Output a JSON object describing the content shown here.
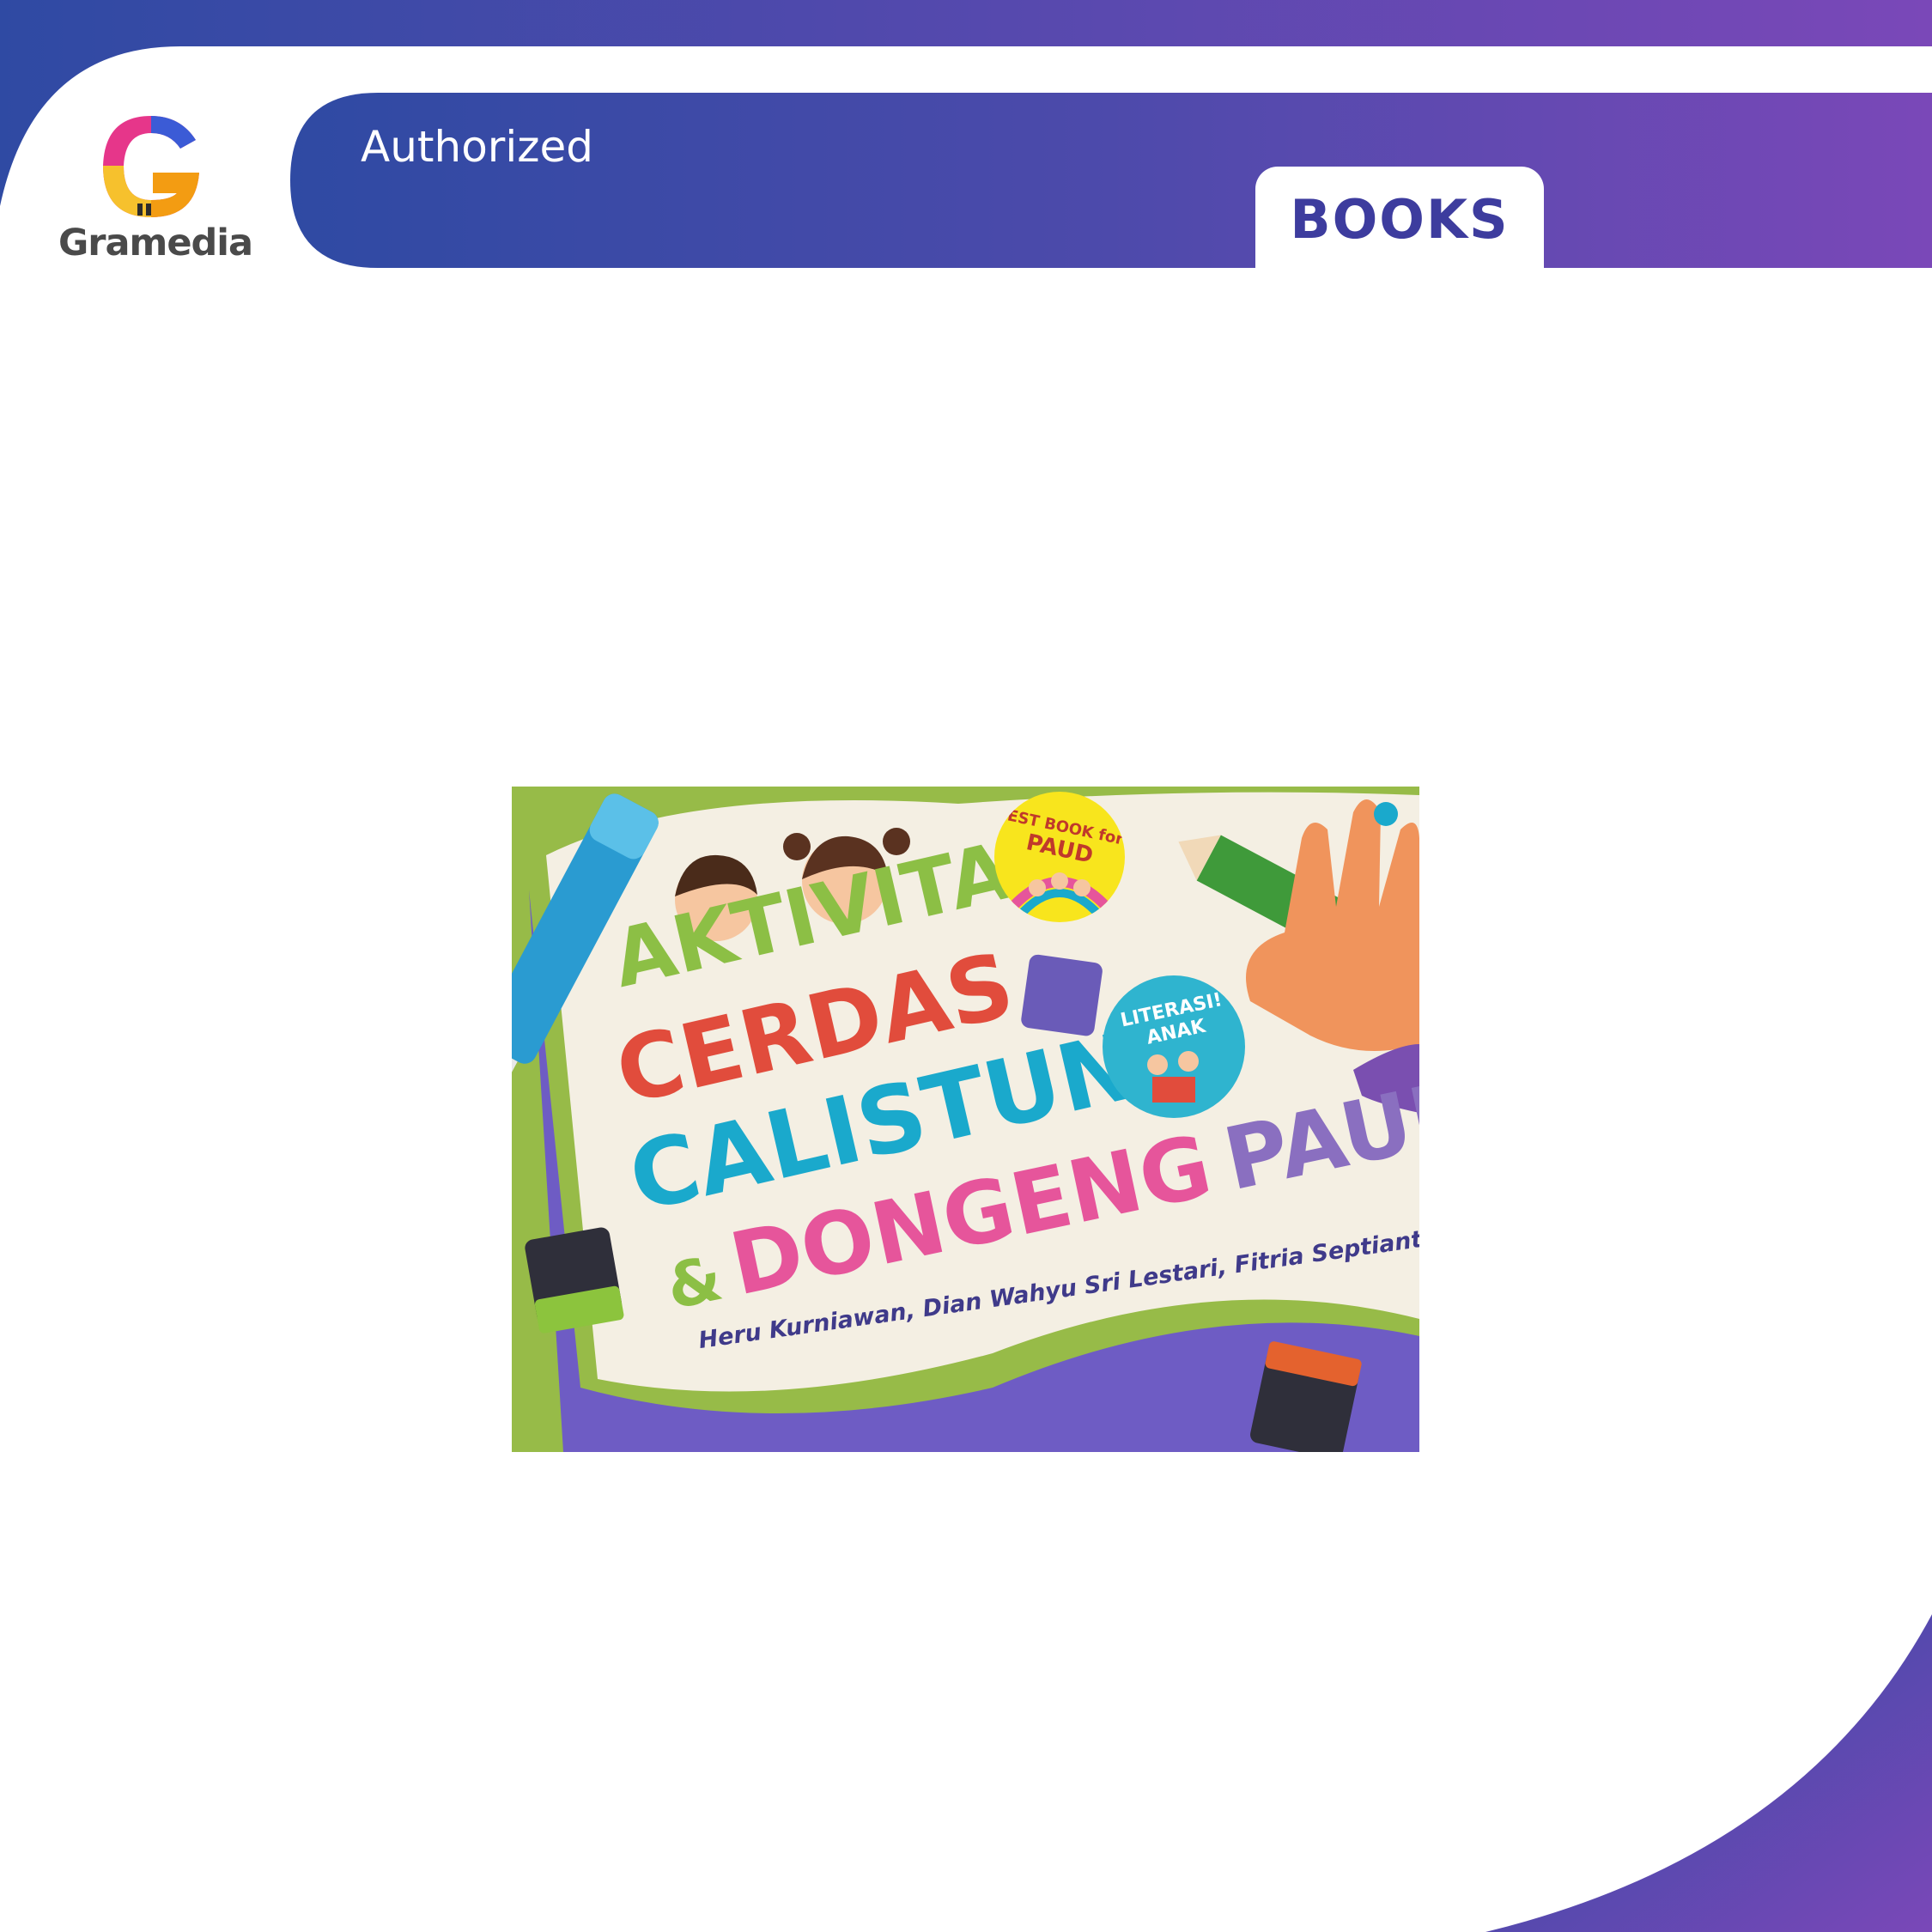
{
  "header": {
    "brand_name": "Gramedia",
    "authorized_label": "Authorized",
    "category_tab": "BOOKS"
  },
  "book_cover": {
    "title_lines": [
      "AKTIVITAS",
      "CERDAS",
      "CALISTUNG"
    ],
    "title_ampersand": "&",
    "title_word_dongeng": "DONGENG",
    "title_word_paud": "PAUD",
    "authors": "Heru Kurniawan, Dian Wahyu Sri Lestari, Fitria Septianti",
    "badge_best_book": "BEST BOOK for",
    "badge_best_book_paud": "PAUD",
    "badge_literasi": "LITERASI! ANAK"
  },
  "colors": {
    "gradient_start": "#2f4aa3",
    "gradient_end": "#7a48b8",
    "books_label": "#3d3c9e",
    "cover_green": "#97bb48"
  },
  "icons": {
    "logo": "gramedia-g-logo",
    "publisher": "publisher-logo"
  }
}
